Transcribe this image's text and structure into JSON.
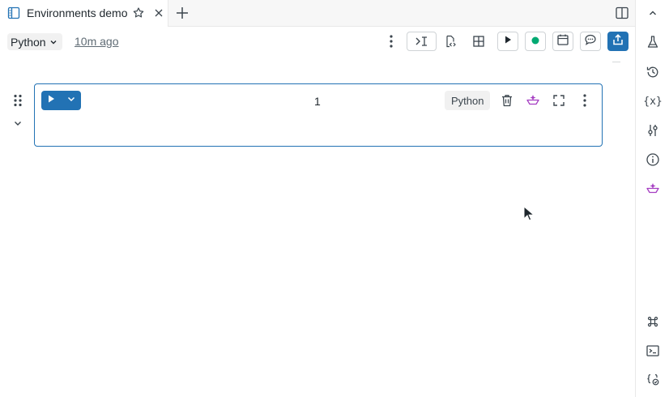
{
  "tab": {
    "title": "Environments demo"
  },
  "toolbar": {
    "language": "Python",
    "last_saved": "10m ago"
  },
  "cell": {
    "index": "1",
    "language": "Python"
  },
  "right_rail": {
    "variables_label": "{x}"
  },
  "colors": {
    "accent": "#2272b4",
    "assistant": "#a53ec2",
    "running": "#00a972"
  },
  "icons": [
    "notebook-icon",
    "star-icon",
    "close-icon",
    "plus-icon",
    "split-view-icon",
    "chevron-down-icon",
    "kebab-menu-icon",
    "run-to-cursor-icon",
    "code-file-icon",
    "layout-grid-icon",
    "play-icon",
    "status-dot-icon",
    "calendar-icon",
    "comment-icon",
    "share-icon",
    "collapse-up-icon",
    "experiment-flask-icon",
    "history-icon",
    "variables-icon",
    "sliders-icon",
    "info-icon",
    "assistant-icon",
    "keyboard-shortcut-icon",
    "terminal-icon",
    "code-check-icon",
    "drag-handle-icon",
    "trash-icon",
    "fullscreen-icon",
    "mouse-cursor-icon"
  ]
}
